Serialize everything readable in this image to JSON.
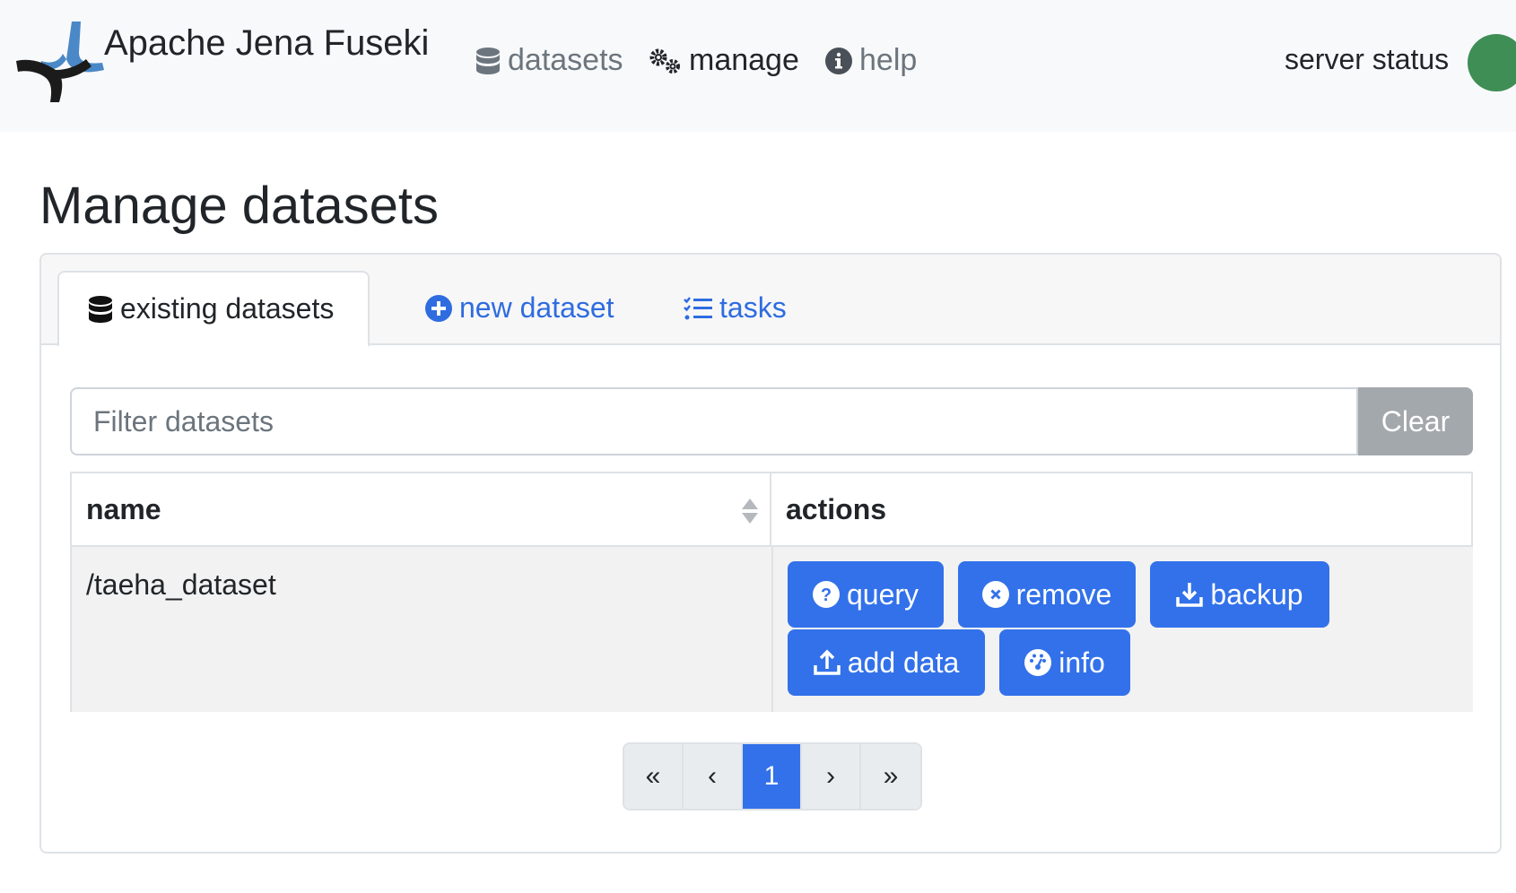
{
  "navbar": {
    "brand": "Apache Jena Fuseki",
    "links": {
      "datasets": "datasets",
      "manage": "manage",
      "help": "help"
    },
    "server_status": "server status",
    "status_color": "#3e8e55"
  },
  "page": {
    "title": "Manage datasets"
  },
  "tabs": {
    "existing": "existing datasets",
    "new": "new dataset",
    "tasks": "tasks"
  },
  "filter": {
    "placeholder": "Filter datasets",
    "value": "",
    "clear_label": "Clear"
  },
  "table": {
    "columns": [
      "name",
      "actions"
    ],
    "rows": [
      {
        "name": "/taeha_dataset"
      }
    ],
    "actions": {
      "query": "query",
      "remove": "remove",
      "backup": "backup",
      "add_data": "add data",
      "info": "info"
    }
  },
  "pagination": {
    "first": "«",
    "prev": "‹",
    "current": "1",
    "next": "›",
    "last": "»"
  },
  "colors": {
    "primary": "#3271ea",
    "secondary": "#a3a8ad",
    "navbar_bg": "#f8f9fa"
  }
}
